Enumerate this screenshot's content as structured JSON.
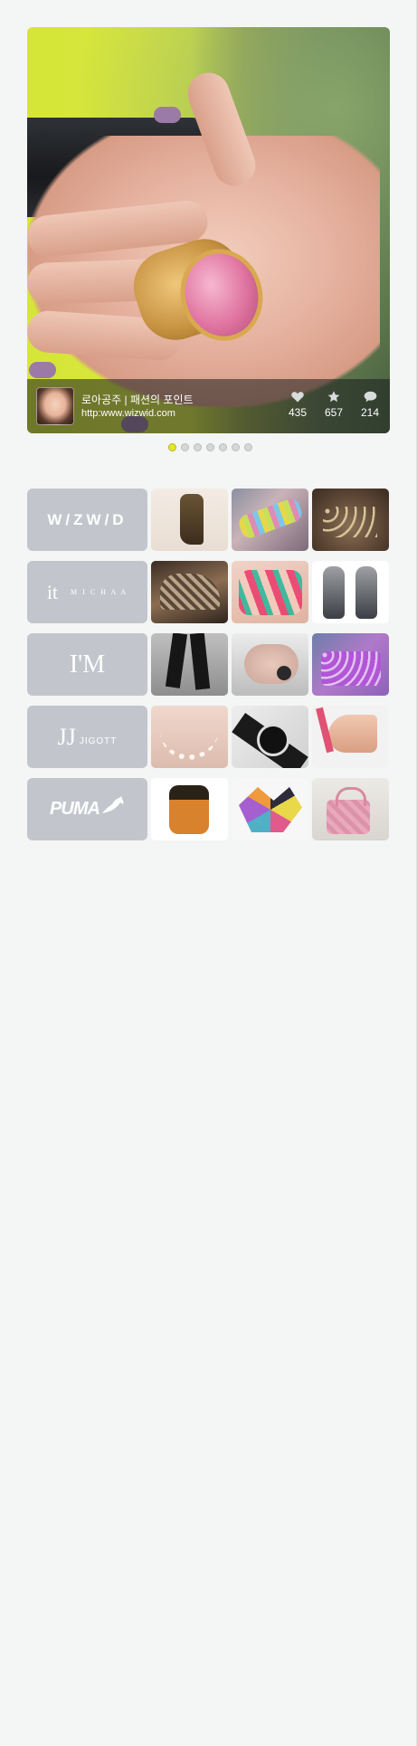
{
  "hero": {
    "title": "로아공주 | 패션의 포인트",
    "url": "http:www.wizwid.com",
    "stats": {
      "likes": "435",
      "favorites": "657",
      "comments": "214"
    },
    "icons": [
      "heart-icon",
      "star-icon",
      "comment-icon"
    ],
    "pager": {
      "count": 7,
      "active": 0
    }
  },
  "brands": [
    {
      "name": "WIZWID",
      "label": "W/ZW/D"
    },
    {
      "name": "it MICHAA",
      "label_main": "it",
      "label_sub": "M I C H A A"
    },
    {
      "name": "I'M",
      "label": "I'M"
    },
    {
      "name": "JJ JIGOTT",
      "label_main": "JJ",
      "label_sub": "JIGOTT"
    },
    {
      "name": "PUMA",
      "label": "PUMA"
    }
  ],
  "colors": {
    "background": "#f4f5f5",
    "brand_tile": "#c2c6cc",
    "dot_active": "#e4e62c",
    "dot_inactive": "#d5d8d8"
  }
}
